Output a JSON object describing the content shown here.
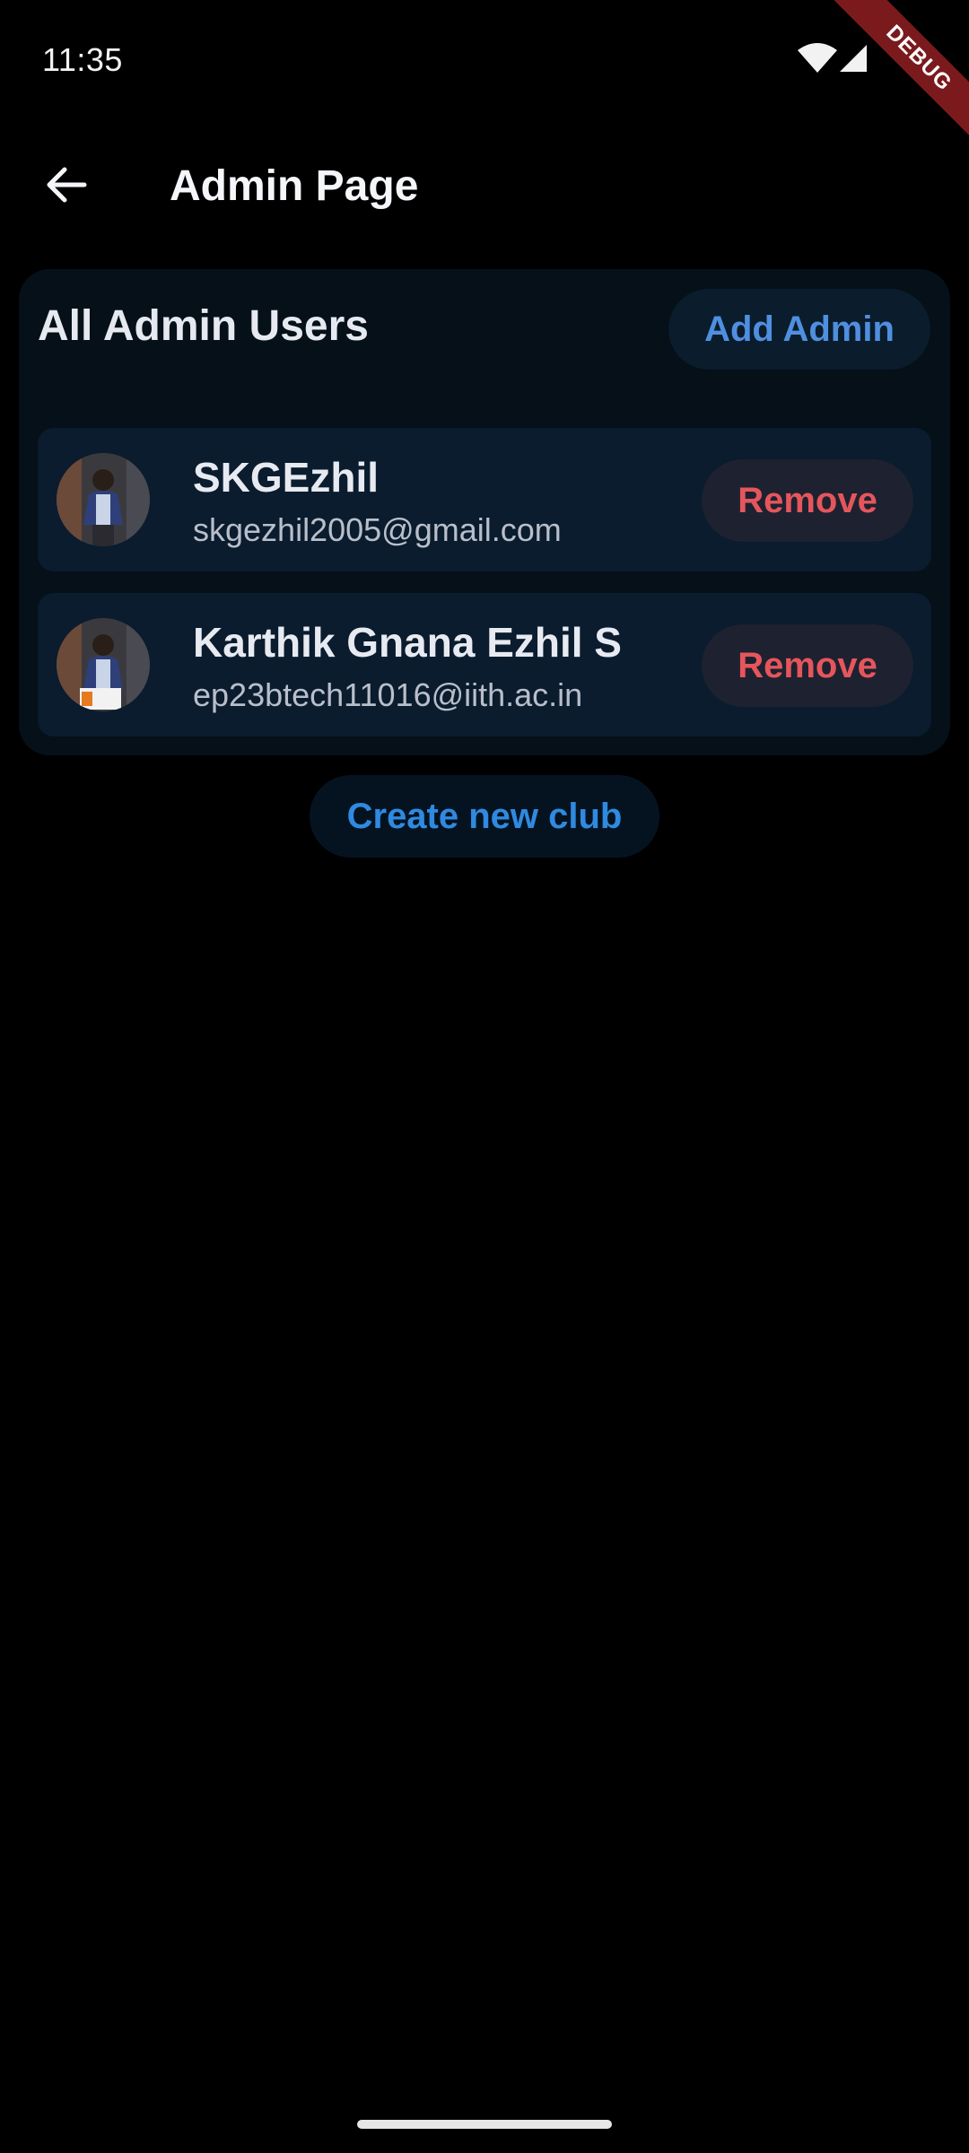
{
  "status_bar": {
    "time": "11:35",
    "wifi_icon": "wifi-icon",
    "signal_icon": "signal-icon"
  },
  "debug_banner": {
    "label": "DEBUG",
    "color": "#7a1a1d"
  },
  "app_bar": {
    "back_icon": "arrow-left-icon",
    "title": "Admin Page"
  },
  "admin_section": {
    "heading": "All Admin Users",
    "add_admin_label": "Add Admin",
    "users": [
      {
        "name": "SKGEzhil",
        "email": "skgezhil2005@gmail.com",
        "remove_label": "Remove"
      },
      {
        "name": "Karthik Gnana Ezhil S",
        "email": "ep23btech11016@iith.ac.in",
        "remove_label": "Remove"
      }
    ]
  },
  "create_club_label": "Create new club",
  "colors": {
    "background": "#000000",
    "card": "#051019",
    "row": "#0a1c2e",
    "accent_blue": "#4f8fe0",
    "danger_red": "#e5565c"
  }
}
